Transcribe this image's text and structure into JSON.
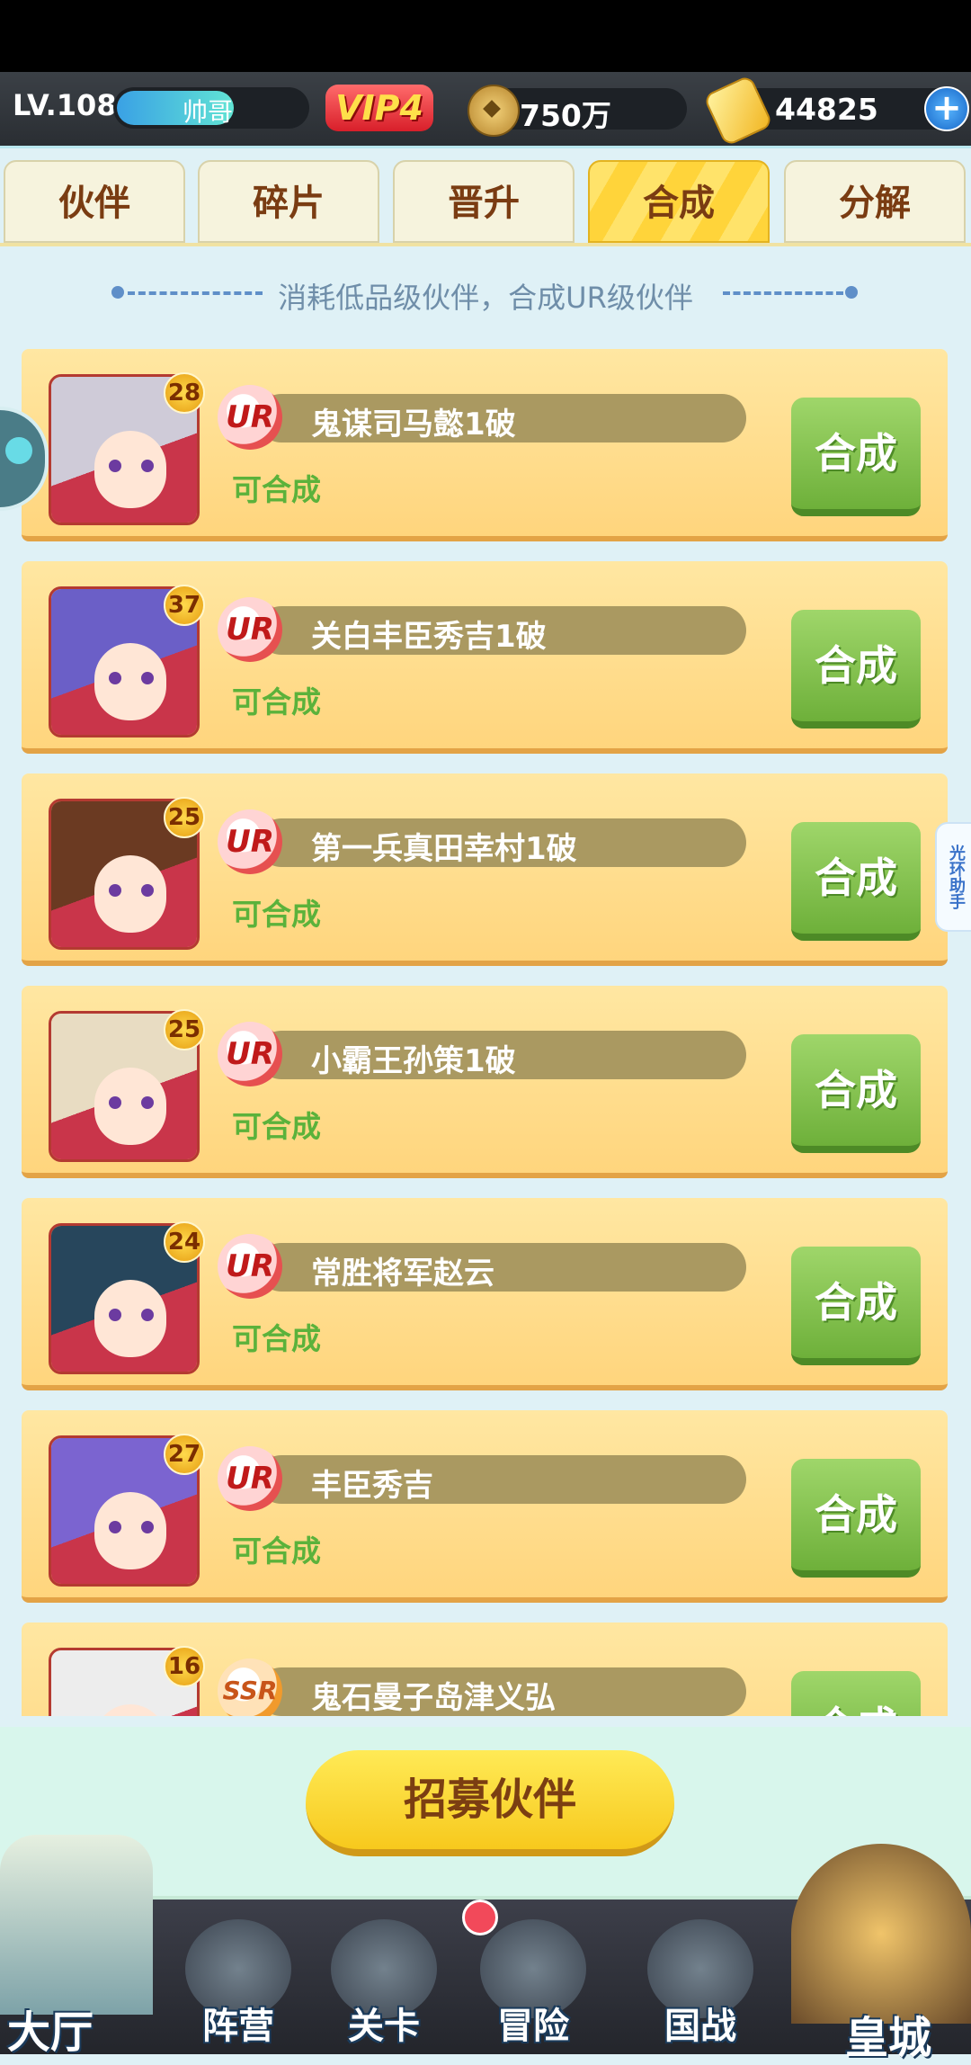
{
  "header": {
    "level": "LV.108",
    "player_name": "帅哥",
    "exp_fraction": 0.62,
    "vip": "VIP4",
    "coins": "750万",
    "gold": "44825",
    "add_symbol": "+"
  },
  "tabs": [
    {
      "label": "伙伴",
      "active": false
    },
    {
      "label": "碎片",
      "active": false
    },
    {
      "label": "晋升",
      "active": false
    },
    {
      "label": "合成",
      "active": true
    },
    {
      "label": "分解",
      "active": false
    }
  ],
  "subtitle": "消耗低品级伙伴，合成UR级伙伴",
  "side_helper": "光环助手",
  "partners": [
    {
      "name": "鬼谋司马懿1破",
      "rarity": "UR",
      "level": "28",
      "status": "可合成",
      "action": "合成",
      "hair": "#cfcbd8"
    },
    {
      "name": "关白丰臣秀吉1破",
      "rarity": "UR",
      "level": "37",
      "status": "可合成",
      "action": "合成",
      "hair": "#6b5fc7"
    },
    {
      "name": "第一兵真田幸村1破",
      "rarity": "UR",
      "level": "25",
      "status": "可合成",
      "action": "合成",
      "hair": "#6b3a22"
    },
    {
      "name": "小霸王孙策1破",
      "rarity": "UR",
      "level": "25",
      "status": "可合成",
      "action": "合成",
      "hair": "#e8dcc2"
    },
    {
      "name": "常胜将军赵云",
      "rarity": "UR",
      "level": "24",
      "status": "可合成",
      "action": "合成",
      "hair": "#27465c"
    },
    {
      "name": "丰臣秀吉",
      "rarity": "UR",
      "level": "27",
      "status": "可合成",
      "action": "合成",
      "hair": "#7b64d0"
    },
    {
      "name": "鬼石曼子岛津义弘",
      "rarity": "SSR",
      "level": "16",
      "status": "",
      "action": "合成",
      "hair": "#ededed"
    }
  ],
  "recruit_button": "招募伙伴",
  "nav": {
    "hall": "大厅",
    "formation": "阵营",
    "stage": "关卡",
    "adventure": "冒险",
    "war": "国战",
    "castle": "皇城"
  }
}
